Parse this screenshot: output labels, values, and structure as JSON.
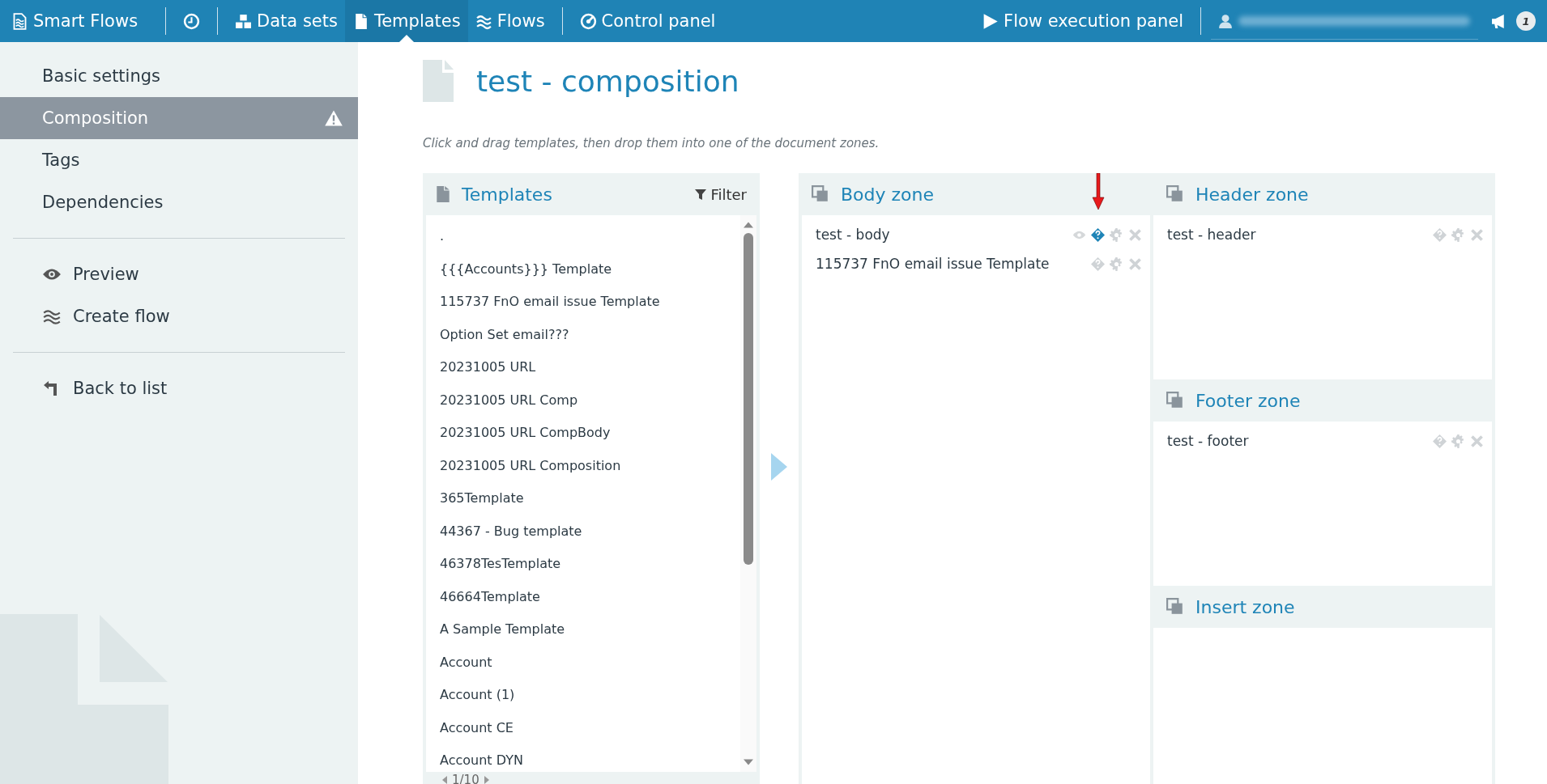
{
  "nav": {
    "brand": "Smart Flows",
    "items": [
      {
        "kind": "history",
        "selected": false
      },
      {
        "kind": "datasets",
        "label": "Data sets",
        "selected": false
      },
      {
        "kind": "templates",
        "label": "Templates",
        "selected": true
      },
      {
        "kind": "flows",
        "label": "Flows",
        "selected": false
      },
      {
        "kind": "control",
        "label": "Control panel",
        "selected": false
      }
    ],
    "execution": "Flow execution panel",
    "notifications": "1"
  },
  "sidebar": {
    "items": [
      {
        "label": "Basic settings",
        "selected": false,
        "warning": false
      },
      {
        "label": "Composition",
        "selected": true,
        "warning": true
      },
      {
        "label": "Tags",
        "selected": false,
        "warning": false
      },
      {
        "label": "Dependencies",
        "selected": false,
        "warning": false
      }
    ],
    "actions": [
      {
        "kind": "preview",
        "label": "Preview"
      },
      {
        "kind": "flow",
        "label": "Create flow"
      }
    ],
    "back": "Back to list"
  },
  "title": "test - composition",
  "hint": "Click and drag templates, then drop them into one of the document zones.",
  "templates": {
    "title": "Templates",
    "filter": "Filter",
    "items": [
      ".",
      "{{{Accounts}}} Template",
      "115737 FnO email issue Template",
      "Option Set email???",
      "20231005 URL",
      "20231005 URL Comp",
      "20231005 URL CompBody",
      "20231005 URL Composition",
      "365Template",
      "44367 - Bug template",
      "46378TesTemplate",
      "46664Template",
      "A Sample Template",
      "Account",
      "Account (1)",
      "Account CE",
      "Account DYN"
    ],
    "pager": "1/10"
  },
  "zones": [
    {
      "title": "Body zone",
      "items": [
        {
          "name": "test - body",
          "preview": true,
          "help_highlighted": true
        },
        {
          "name": "115737 FnO email issue Template",
          "preview": false,
          "help_highlighted": false
        }
      ]
    },
    {
      "title": "Header zone",
      "items": [
        {
          "name": "test - header",
          "preview": false,
          "help_highlighted": false
        }
      ]
    },
    {
      "title": "Footer zone",
      "items": [
        {
          "name": "test - footer",
          "preview": false,
          "help_highlighted": false
        }
      ]
    },
    {
      "title": "Insert zone"
    }
  ]
}
